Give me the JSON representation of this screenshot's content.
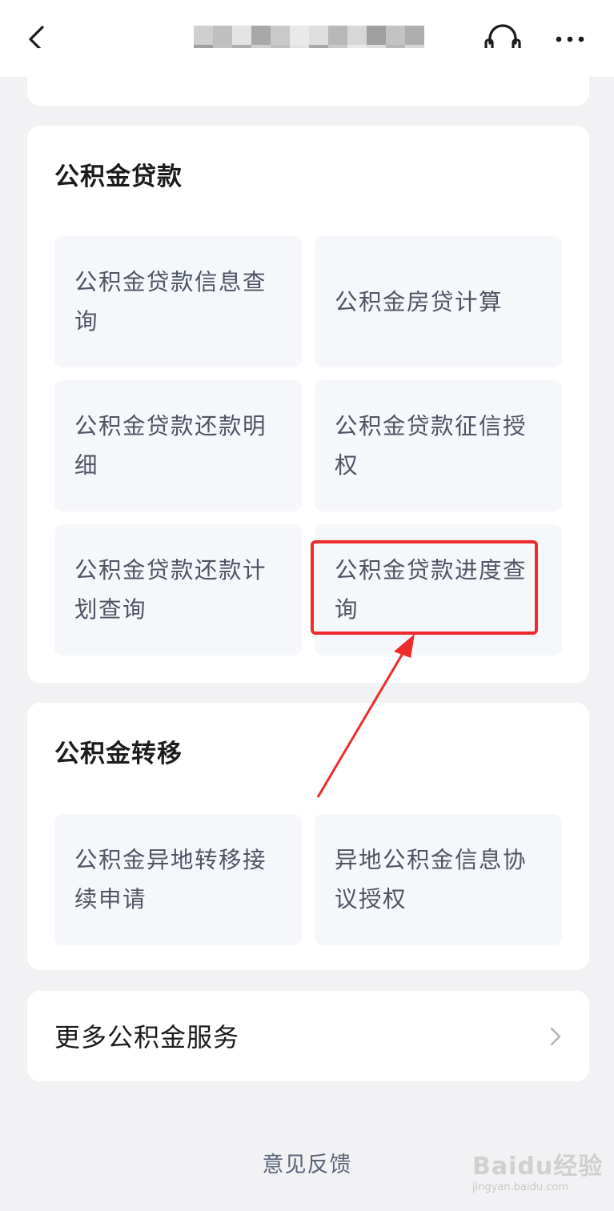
{
  "nav": {
    "back_icon": "chevron-left-icon",
    "service_icon": "headset-icon",
    "more_icon": "more-dots-icon"
  },
  "loan_section": {
    "title": "公积金贷款",
    "items": [
      {
        "label_line1": "公积金贷款信息查",
        "label_line2": "询"
      },
      {
        "label_line1": "公积金房贷计算",
        "label_line2": ""
      },
      {
        "label_line1": "公积金贷款还款明",
        "label_line2": "细"
      },
      {
        "label_line1": "公积金贷款征信授",
        "label_line2": "权"
      },
      {
        "label_line1": "公积金贷款还款计",
        "label_line2": "划查询"
      },
      {
        "label_line1": "公积金贷款进度查",
        "label_line2": "询"
      }
    ]
  },
  "transfer_section": {
    "title": "公积金转移",
    "items": [
      {
        "label_line1": "公积金异地转移接",
        "label_line2": "续申请"
      },
      {
        "label_line1": "异地公积金信息协",
        "label_line2": "议授权"
      }
    ]
  },
  "more_services": {
    "label": "更多公积金服务",
    "icon": "chevron-right-icon"
  },
  "feedback": {
    "label": "意见反馈"
  },
  "watermark": {
    "main": "Baidu经验",
    "sub": "jingyan.baidu.com"
  },
  "colors": {
    "highlight": "#ef2b2b",
    "tile_bg": "#f6f7fa",
    "page_bg": "#f2f2f4",
    "tile_text": "#4e5563"
  }
}
